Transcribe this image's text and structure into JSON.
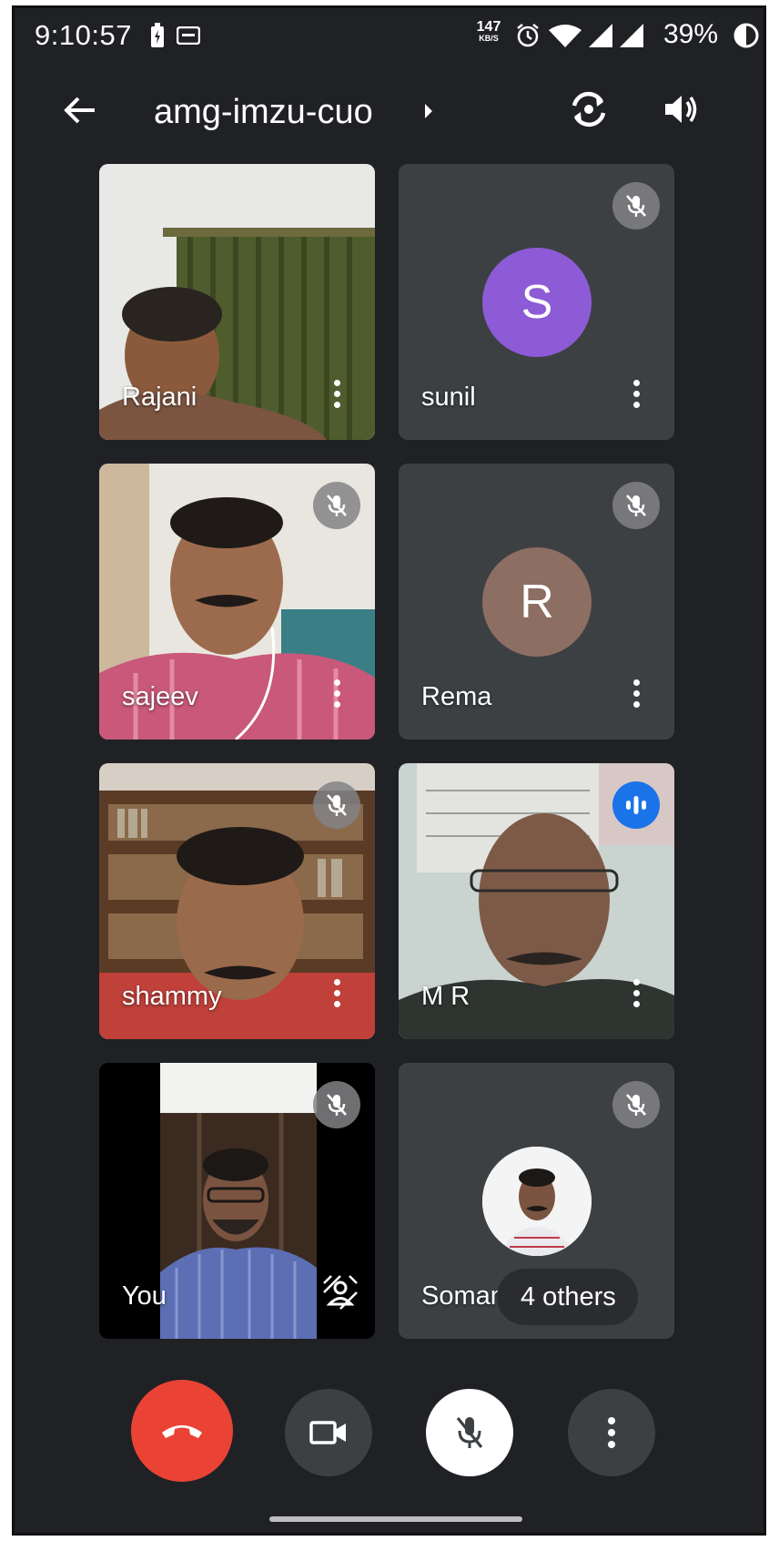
{
  "status_bar": {
    "time": "9:10:57",
    "net_speed_value": "147",
    "net_speed_unit": "KB/S",
    "battery": "39%"
  },
  "app_bar": {
    "meeting_code": "amg-imzu-cuo"
  },
  "participants": [
    {
      "name": "Rajani",
      "type": "video",
      "muted": false
    },
    {
      "name": "sunil",
      "type": "avatar",
      "initial": "S",
      "avatar_color": "#8e5bd6",
      "muted": true
    },
    {
      "name": "sajeev",
      "type": "video",
      "muted": true
    },
    {
      "name": "Rema",
      "type": "avatar",
      "initial": "R",
      "avatar_color": "#8d6e63",
      "muted": true
    },
    {
      "name": "shammy",
      "type": "video",
      "muted": true
    },
    {
      "name": "M R",
      "type": "video",
      "muted": false,
      "speaking": true,
      "speaking_color": "#1a73e8"
    },
    {
      "name": "You",
      "type": "self-video",
      "muted": true
    },
    {
      "name": "Soman",
      "type": "photo-avatar",
      "muted": true,
      "others_label": "4 others"
    }
  ],
  "controls": {
    "end_call_color": "#ea4335",
    "mic_state": "muted"
  },
  "colors": {
    "background": "#202124",
    "tile": "#3c4043"
  }
}
